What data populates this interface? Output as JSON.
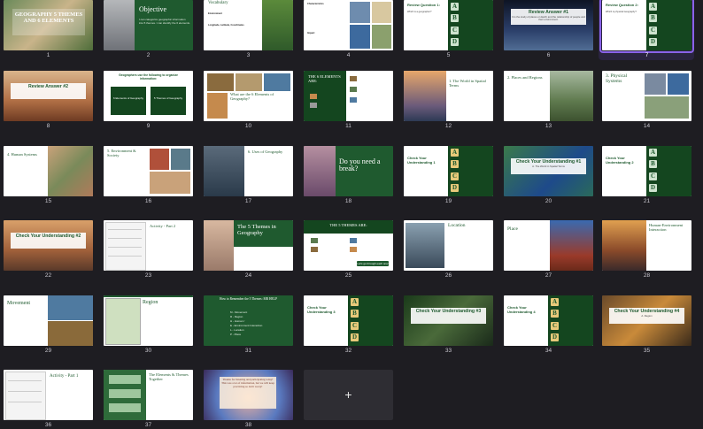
{
  "slides": {
    "s1": {
      "num": "1",
      "title": "GEOGRAPHY 5 THEMES AND 6 ELEMENTS"
    },
    "s2": {
      "num": "2",
      "title": "Objective",
      "body": "I can categorize geographic information into 5 themes. I can identify the 6 elements."
    },
    "s3": {
      "num": "3",
      "title": "Vocabulary",
      "t1": "Environment",
      "t2": "Longitude, Latitude, Coordinates"
    },
    "s4": {
      "num": "4",
      "t1": "Characteristics",
      "t2": "Impact"
    },
    "s5": {
      "num": "5",
      "title": "Review Question 1:",
      "sub": "Which is a geographer?"
    },
    "s6": {
      "num": "6",
      "title": "Review Answer #1",
      "sub": "It is the study of places on Earth and the relationship of people and their environment."
    },
    "s7": {
      "num": "7",
      "title": "Review Question 2:",
      "sub": "Which is physical Geography?"
    },
    "s8": {
      "num": "8",
      "title": "Review Answer #2"
    },
    "s9": {
      "num": "9",
      "title": "Geographers use the following to organize information:",
      "b1": "6 Elements of Geography",
      "b2": "5 Themes of Geography"
    },
    "s10": {
      "num": "10",
      "title": "What are the 6 Elements of Geography?"
    },
    "s11": {
      "num": "11",
      "title": "THE 6 ELEMENTS ARE:"
    },
    "s12": {
      "num": "12",
      "title": "1. The World in Spatial Terms"
    },
    "s13": {
      "num": "13",
      "title": "2. Places and Regions"
    },
    "s14": {
      "num": "14",
      "title": "3. Physical Systems"
    },
    "s15": {
      "num": "15",
      "title": "4. Human Systems"
    },
    "s16": {
      "num": "16",
      "title": "5. Environment & Society"
    },
    "s17": {
      "num": "17",
      "title": "6. Uses of Geography"
    },
    "s18": {
      "num": "18",
      "title": "Do you need a break?"
    },
    "s19": {
      "num": "19",
      "title": "Check Your Understanding 1"
    },
    "s20": {
      "num": "20",
      "title": "Check Your Understanding #1",
      "sub": "A. The World in Spatial Terms"
    },
    "s21": {
      "num": "21",
      "title": "Check Your Understanding 2"
    },
    "s22": {
      "num": "22",
      "title": "Check Your Understanding #2"
    },
    "s23": {
      "num": "23",
      "title": "Activity - Part 2"
    },
    "s24": {
      "num": "24",
      "title": "The 5 Themes in Geography"
    },
    "s25": {
      "num": "25",
      "title": "THE 5 THEMES ARE:",
      "btn": "Let's go through each one!"
    },
    "s26": {
      "num": "26",
      "title": "Location"
    },
    "s27": {
      "num": "27",
      "title": "Place"
    },
    "s28": {
      "num": "28",
      "title": "Human-Environment Interaction"
    },
    "s29": {
      "num": "29",
      "title": "Movement"
    },
    "s30": {
      "num": "30",
      "title": "Region"
    },
    "s31": {
      "num": "31",
      "title": "How to Remember the 5 Themes: MR HELP",
      "items": [
        "M - Movement",
        "R - Region",
        "H - Human /",
        "E - Environment Interaction",
        "L - Location",
        "P - Place"
      ]
    },
    "s32": {
      "num": "32",
      "title": "Check Your Understanding 3"
    },
    "s33": {
      "num": "33",
      "title": "Check Your Understanding #3"
    },
    "s34": {
      "num": "34",
      "title": "Check Your Understanding 4"
    },
    "s35": {
      "num": "35",
      "title": "Check Your Understanding #4",
      "sub": "A. Region"
    },
    "s36": {
      "num": "36",
      "title": "Activity - Part 1"
    },
    "s37": {
      "num": "37",
      "title": "The Elements & Themes Together"
    },
    "s38": {
      "num": "38",
      "title": "Thanks for listening and participating today! This was a lot of information, but we will keep practicing so don't worry!"
    }
  },
  "letters": [
    "A",
    "B",
    "C",
    "D"
  ],
  "add_slide": "+",
  "colors": {
    "accent": "#1f5a2f",
    "selection": "#8a63e8",
    "background": "#1e1d22"
  }
}
